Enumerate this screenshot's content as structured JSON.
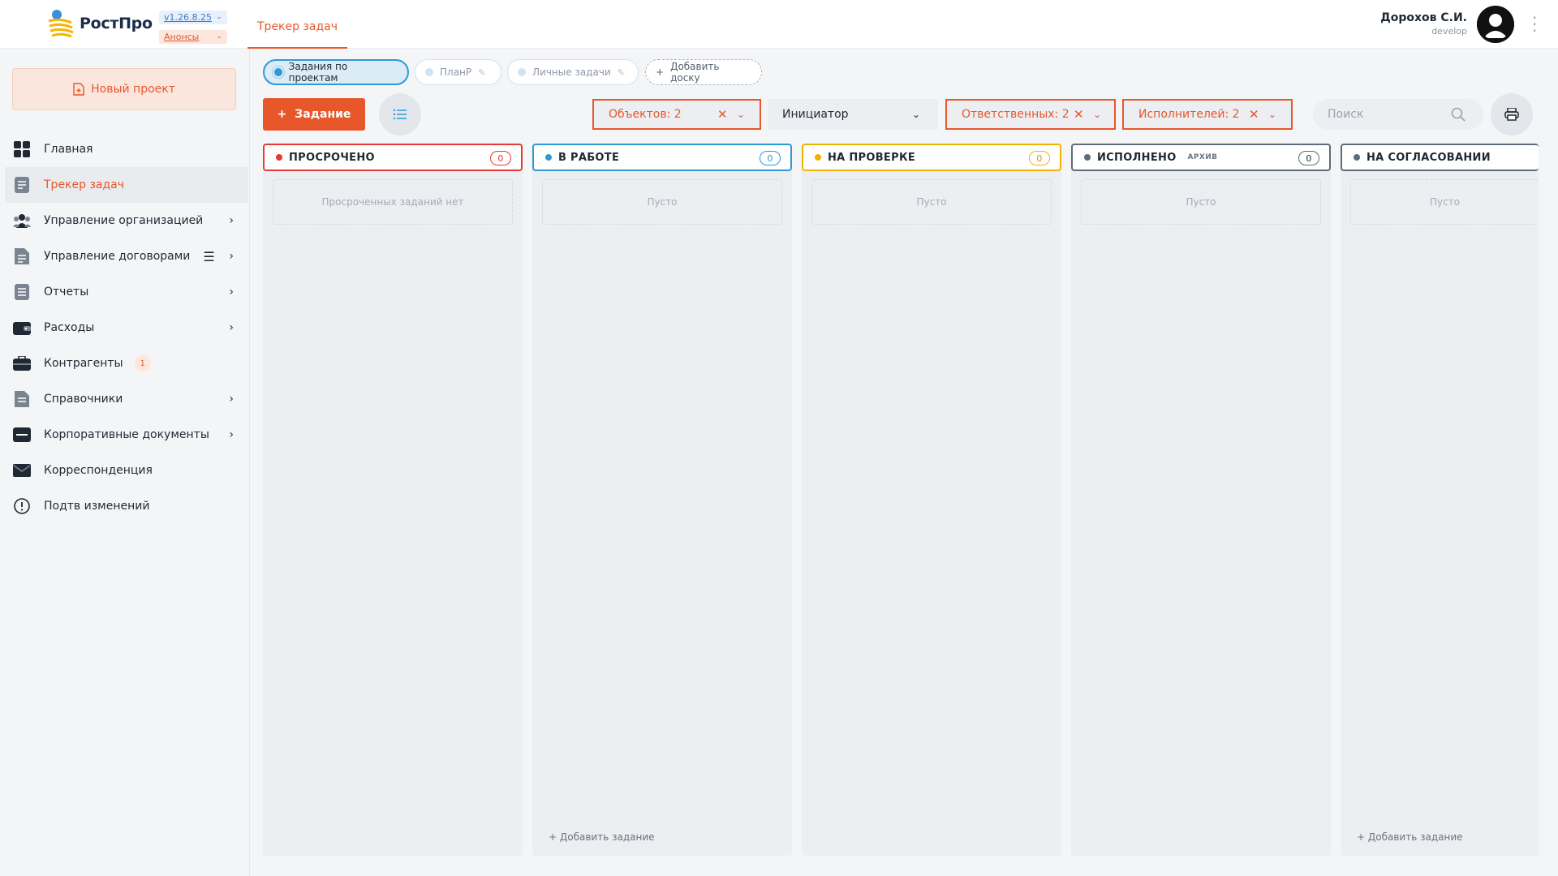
{
  "header": {
    "logo_text_a": "Рост",
    "logo_text_b": "Про",
    "version": "v1.26.8.25",
    "announcements": "Анонсы",
    "active_tab": "Трекер задач",
    "user_name": "Дорохов С.И.",
    "user_role": "develop"
  },
  "sidebar": {
    "new_project": "Новый проект",
    "items": [
      {
        "label": "Главная"
      },
      {
        "label": "Трекер задач"
      },
      {
        "label": "Управление организацией"
      },
      {
        "label": "Управление договорами"
      },
      {
        "label": "Отчеты"
      },
      {
        "label": "Расходы"
      },
      {
        "label": "Контрагенты",
        "badge": "1"
      },
      {
        "label": "Справочники"
      },
      {
        "label": "Корпоративные документы"
      },
      {
        "label": "Корреспонденция"
      },
      {
        "label": "Подтв изменений"
      }
    ]
  },
  "boards": {
    "tabs": [
      {
        "label": "Задания по проектам"
      },
      {
        "label": "ПланР"
      },
      {
        "label": "Личные задачи"
      }
    ],
    "add_board": "Добавить доску"
  },
  "toolbar": {
    "add_task": "Задание",
    "filter_objects": "Объектов: 2",
    "filter_initiator": "Инициатор",
    "filter_responsible": "Ответственных: 2",
    "filter_executors": "Исполнителей: 2",
    "search_placeholder": "Поиск"
  },
  "columns": [
    {
      "title": "ПРОСРОЧЕНО",
      "count": "0",
      "empty": "Просроченных заданий нет",
      "color": "#e53935"
    },
    {
      "title": "В РАБОТЕ",
      "count": "0",
      "empty": "Пусто",
      "add": "Добавить задание",
      "color": "#2d9ad6"
    },
    {
      "title": "НА ПРОВЕРКЕ",
      "count": "0",
      "empty": "Пусто",
      "color": "#f0b400"
    },
    {
      "title": "ИСПОЛНЕНО",
      "archive": "АРХИВ",
      "count": "0",
      "empty": "Пусто",
      "color": "#5f6b78"
    },
    {
      "title": "НА СОГЛАСОВАНИИ",
      "empty": "Пусто",
      "add": "Добавить задание",
      "color": "#5f6b78"
    }
  ],
  "colors": {
    "accent": "#e8572a",
    "blue": "#2d9ad6",
    "text": "#1f2933"
  }
}
